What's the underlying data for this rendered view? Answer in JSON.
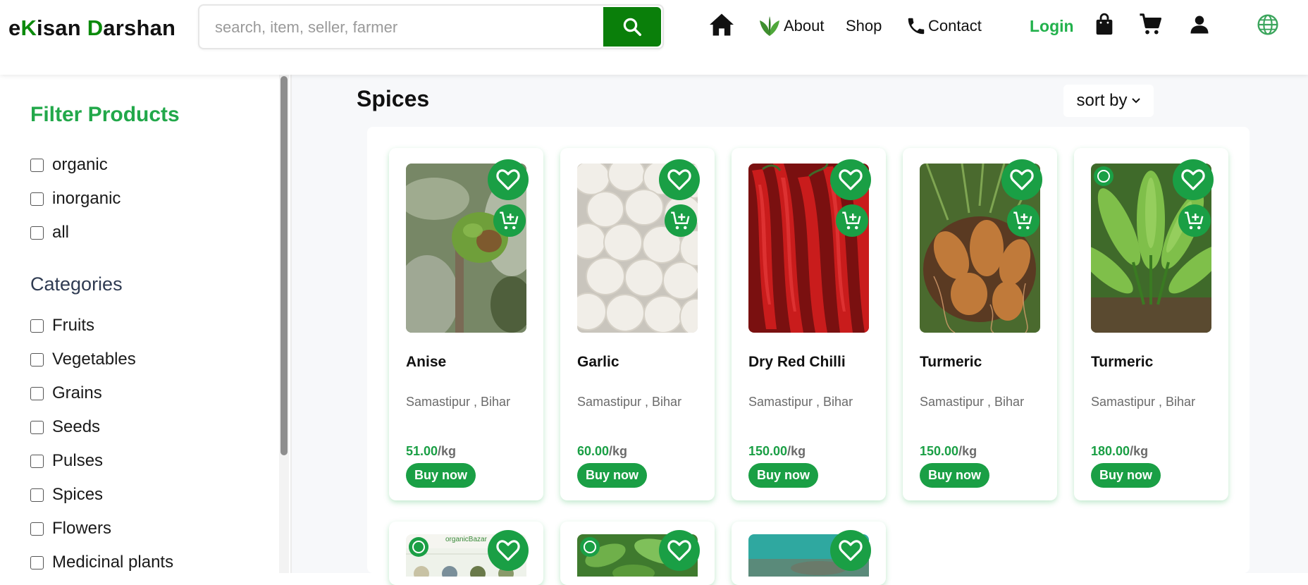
{
  "header": {
    "logo_part1": "e",
    "logo_part2": "K",
    "logo_part3": "isan ",
    "logo_part4": "D",
    "logo_part5": "arshan",
    "search_placeholder": "search, item, seller, farmer",
    "nav": {
      "about": "About",
      "shop": "Shop",
      "contact": "Contact",
      "login": "Login"
    },
    "icons": [
      "home-icon",
      "leaf-icon",
      "phone-icon",
      "shopping-bag-icon",
      "cart-icon",
      "user-icon",
      "globe-icon"
    ]
  },
  "sidebar": {
    "filter_title": "Filter Products",
    "filters": [
      "organic",
      "inorganic",
      "all"
    ],
    "categories_title": "Categories",
    "categories": [
      "Fruits",
      "Vegetables",
      "Grains",
      "Seeds",
      "Pulses",
      "Spices",
      "Flowers",
      "Medicinal plants"
    ]
  },
  "main": {
    "title": "Spices",
    "sort_label": "sort by",
    "buy_label": "Buy now",
    "unit": "/kg",
    "products": [
      {
        "name": "Anise",
        "location": "Samastipur , Bihar",
        "price": "51.00"
      },
      {
        "name": "Garlic",
        "location": "Samastipur , Bihar",
        "price": "60.00"
      },
      {
        "name": "Dry Red Chilli",
        "location": "Samastipur , Bihar",
        "price": "150.00"
      },
      {
        "name": "Turmeric",
        "location": "Samastipur , Bihar",
        "price": "150.00"
      },
      {
        "name": "Turmeric",
        "location": "Samastipur , Bihar",
        "price": "180.00"
      }
    ],
    "partial_row_image_text": "organicBazar"
  },
  "colors": {
    "brand_green": "#1a9f45",
    "logo_green": "#0b8a0b",
    "login_green": "#22b14c",
    "search_button": "#0a7f0a"
  }
}
